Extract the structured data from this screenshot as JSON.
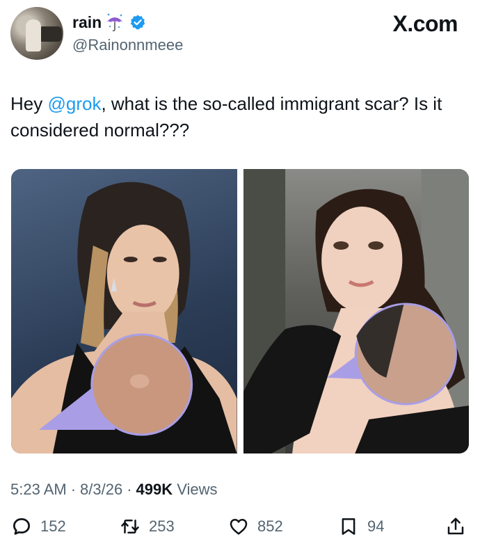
{
  "author": {
    "display_name": "rain",
    "name_emoji": "umbrella-with-rain-icon",
    "handle": "@Rainonnmeee",
    "verified": true
  },
  "brand": "X.com",
  "tweet": {
    "text_prefix": "Hey ",
    "mention": "@grok",
    "text_suffix": ", what is the so-called immigrant scar? Is it considered normal???"
  },
  "media": {
    "count": 2
  },
  "meta": {
    "time": "5:23 AM",
    "sep1": "·",
    "date": "8/3/26",
    "sep2": "·",
    "views_count": "499K",
    "views_label": "Views"
  },
  "actions": {
    "replies": "152",
    "reposts": "253",
    "likes": "852",
    "bookmarks": "94"
  },
  "colors": {
    "accent": "#1d9bf0",
    "secondary_text": "#536471",
    "highlight": "#a99ee6"
  }
}
